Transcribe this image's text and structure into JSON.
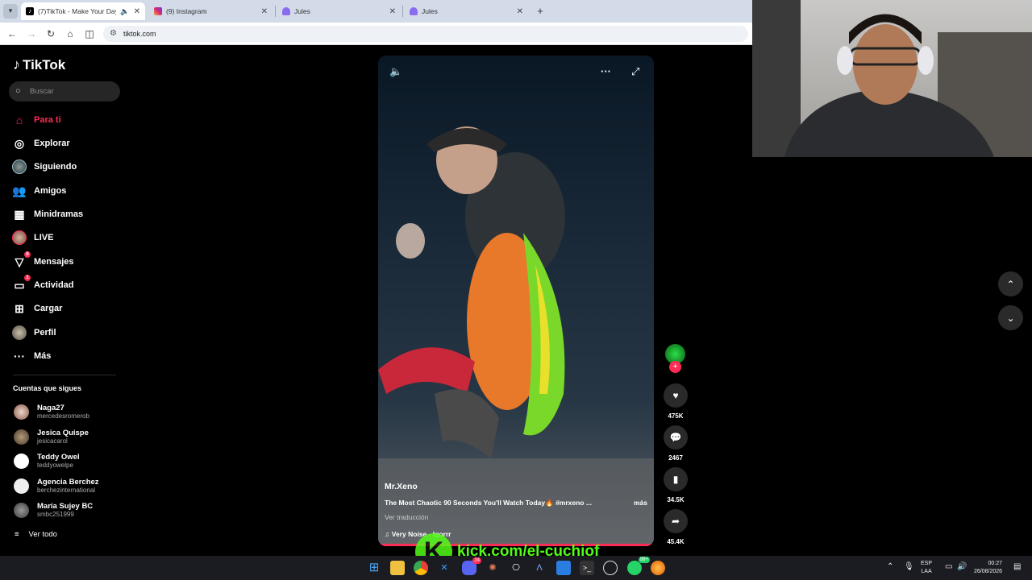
{
  "browser": {
    "tabs": [
      {
        "title": "(7)TikTok - Make Your Day",
        "active": true,
        "fav": "tiktok-icon"
      },
      {
        "title": "(9) Instagram",
        "active": false,
        "fav": "instagram-icon"
      },
      {
        "title": "Jules",
        "active": false,
        "fav": "jules-icon"
      },
      {
        "title": "Jules",
        "active": false,
        "fav": "jules-icon"
      }
    ],
    "url": "tiktok.com"
  },
  "sidebar": {
    "brand": "TikTok",
    "search_placeholder": "Buscar",
    "nav": [
      {
        "label": "Para ti",
        "icon": "home-icon",
        "active": true
      },
      {
        "label": "Explorar",
        "icon": "compass-icon"
      },
      {
        "label": "Siguiendo",
        "icon": "following-avatar-icon"
      },
      {
        "label": "Amigos",
        "icon": "friends-icon"
      },
      {
        "label": "Minidramas",
        "icon": "film-icon"
      },
      {
        "label": "LIVE",
        "icon": "live-icon"
      },
      {
        "label": "Mensajes",
        "icon": "send-icon",
        "badge": "6"
      },
      {
        "label": "Actividad",
        "icon": "activity-icon",
        "badge": "1"
      },
      {
        "label": "Cargar",
        "icon": "upload-icon"
      },
      {
        "label": "Perfil",
        "icon": "profile-avatar-icon"
      },
      {
        "label": "Más",
        "icon": "more-icon"
      }
    ],
    "following_title": "Cuentas que sigues",
    "following": [
      {
        "name": "Naga27",
        "user": "mercedesromerob"
      },
      {
        "name": "Jesica Quispe",
        "user": "jesicacarol"
      },
      {
        "name": "Teddy Owel",
        "user": "teddyowelpe"
      },
      {
        "name": "Agencia Berchez",
        "user": "berchezinternational"
      },
      {
        "name": "María Sujey BC",
        "user": "smbc251999"
      }
    ],
    "see_all": "Ver todo"
  },
  "video": {
    "author": "Mr.Xeno",
    "description": "The Most Chaotic 90 Seconds You'll Watch Today🔥 #mrxeno ...",
    "more": "más",
    "translate": "Ver traducción",
    "music": "Very Noise - Igorrr",
    "progress": 1.0,
    "likes": "475K",
    "comments": "2467",
    "saves": "34.5K",
    "shares": "45.4K"
  },
  "overlay": {
    "kick_letter": "K",
    "kick_text": "kick.com/el-cuchiof"
  },
  "taskbar": {
    "lang_top": "ESP",
    "lang_bottom": "LAA",
    "time": "00:27",
    "date": "26/08/2026",
    "discord_badge": "24",
    "whatsapp_badge": "99+"
  },
  "colors": {
    "accent": "#fe2c55",
    "kick": "#53fc18"
  }
}
